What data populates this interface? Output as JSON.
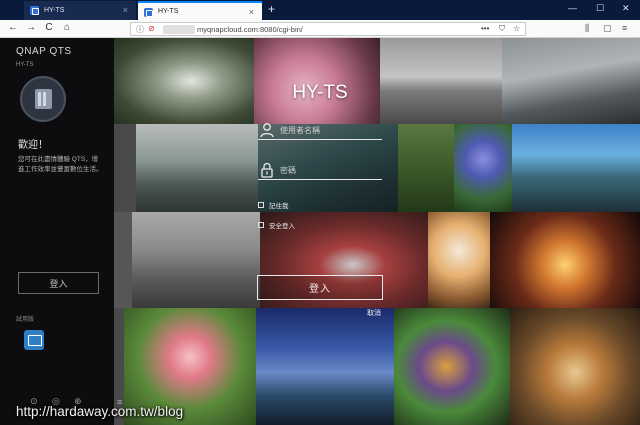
{
  "browser": {
    "tabs": [
      {
        "title": "HY-TS",
        "active": false
      },
      {
        "title": "HY-TS",
        "active": true
      }
    ],
    "new_tab": "+",
    "window_controls": {
      "minimize": "—",
      "maximize": "☐",
      "close": "✕"
    },
    "tab_close": "×",
    "nav": {
      "back": "←",
      "forward": "→",
      "reload": "C",
      "home": "⌂"
    },
    "url": "myqnapcloud.com:8080/cgi-bin/",
    "url_actions": {
      "more": "•••",
      "pocket": "⛉",
      "bookmark": "☆"
    },
    "toolbar": {
      "library": "⫼",
      "sidebar": "▢",
      "menu": "≡"
    }
  },
  "sidebar": {
    "brand": "QNAP QTS",
    "host": "HY-TS",
    "welcome": "歡迎！",
    "description": "您可在此盡情體驗 QTS，增進工作效率並豐富數位生活。",
    "login_label": "登入",
    "try_label": "試用版",
    "bottom_icons": [
      "⊙",
      "◎",
      "⊕"
    ]
  },
  "login": {
    "title": "HY-TS",
    "username_placeholder": "使用者名稱",
    "password_placeholder": "密碼",
    "remember_me": "記住我",
    "secure_login": "安全登入",
    "login_button": "登入",
    "cancel": "取消"
  },
  "watermark": "http://hardaway.com.tw/blog",
  "menu_icon": "≡"
}
